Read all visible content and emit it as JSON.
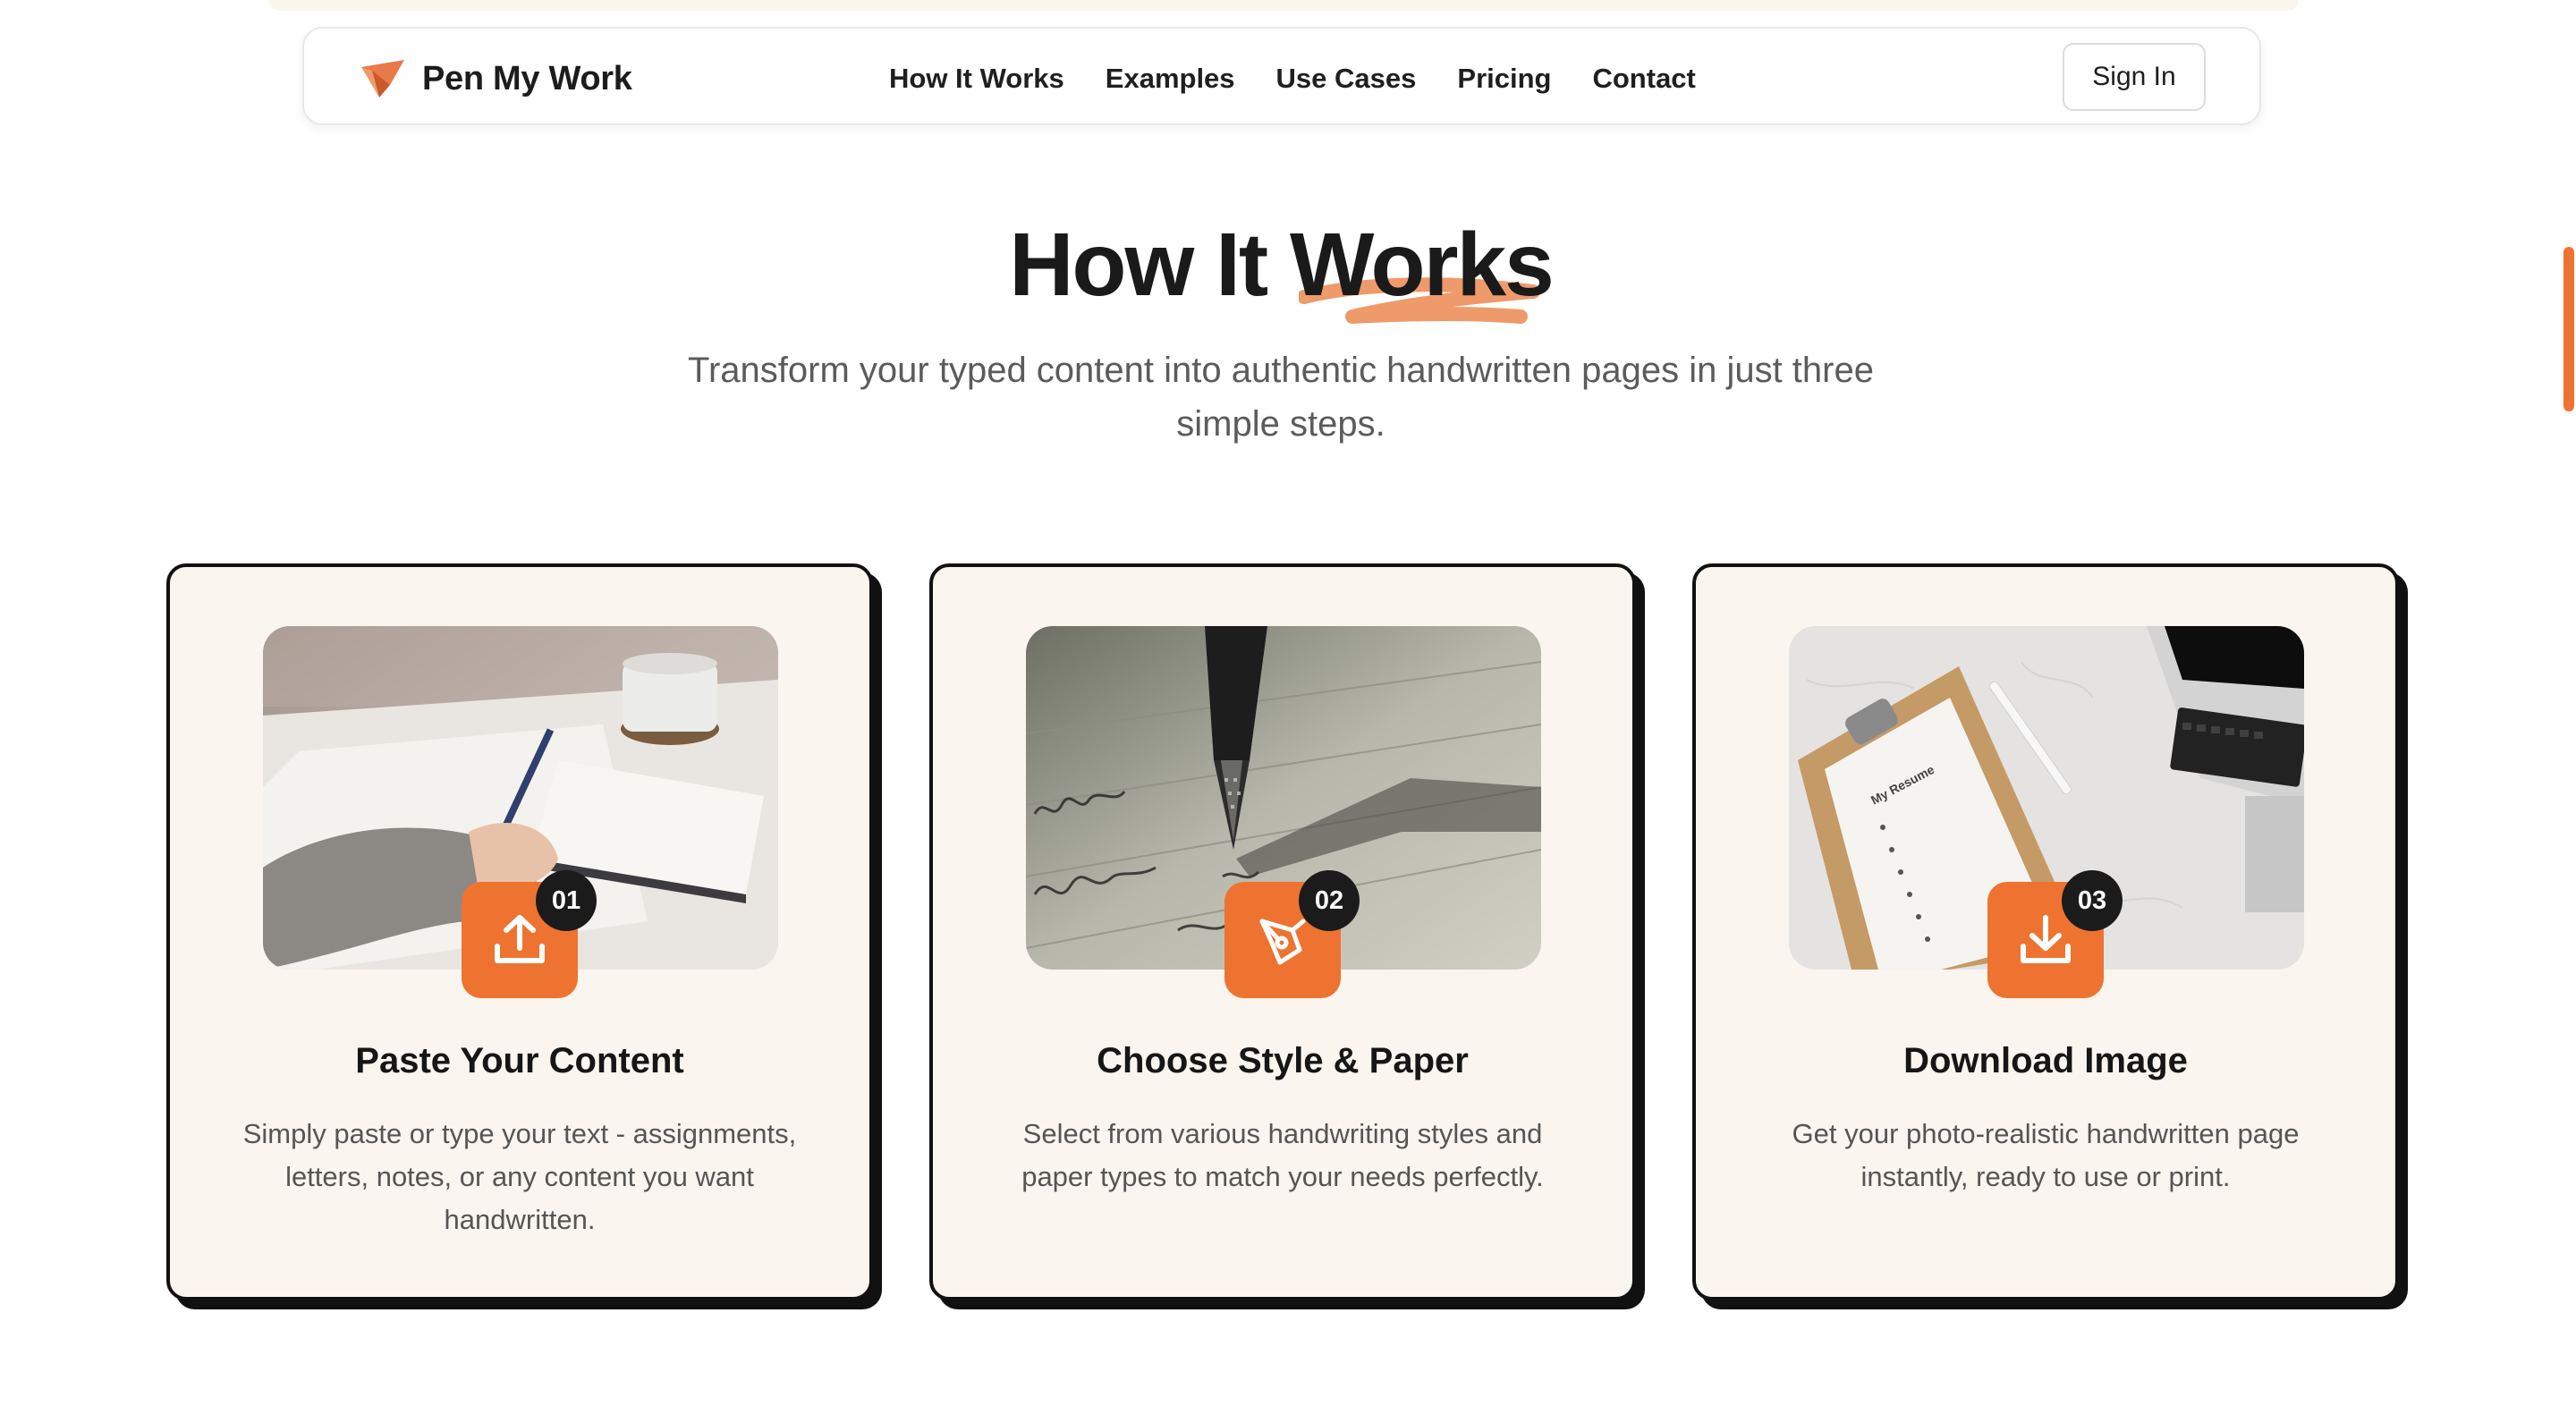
{
  "nav": {
    "brand": "Pen My Work",
    "links": [
      "How It Works",
      "Examples",
      "Use Cases",
      "Pricing",
      "Contact"
    ],
    "sign_in": "Sign In"
  },
  "section": {
    "title_part1": "How It ",
    "title_highlight": "Works",
    "subtitle": "Transform your typed content into authentic handwritten pages in just three simple steps."
  },
  "steps": [
    {
      "number": "01",
      "icon": "upload-icon",
      "image": "person-writing-at-desk-photo",
      "title": "Paste Your Content",
      "description": "Simply paste or type your text - assignments, letters, notes, or any content you want handwritten."
    },
    {
      "number": "02",
      "icon": "pen-nib-icon",
      "image": "fountain-pen-writing-photo",
      "title": "Choose Style & Paper",
      "description": "Select from various handwriting styles and paper types to match your needs perfectly."
    },
    {
      "number": "03",
      "icon": "download-icon",
      "image": "clipboard-resume-laptop-photo",
      "title": "Download Image",
      "description": "Get your photo-realistic handwritten page instantly, ready to use or print."
    }
  ],
  "image_text": {
    "clipboard_heading": "My Resume"
  },
  "colors": {
    "accent": "#ee7330",
    "card_bg": "#faf5ee",
    "border": "#111111",
    "badge": "#1b1b1b"
  }
}
